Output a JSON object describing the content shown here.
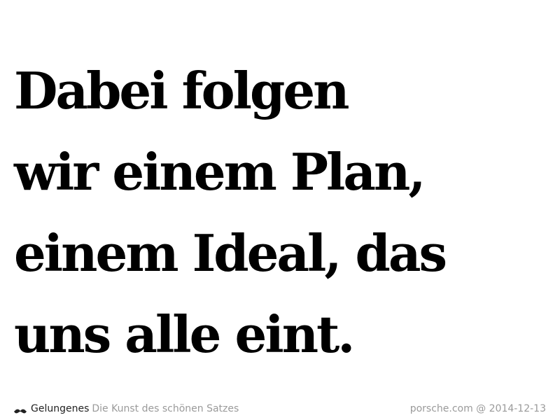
{
  "quote": {
    "lines": [
      "Dabei folgen",
      "wir einem Plan,",
      "einem Ideal, das",
      "uns alle eint."
    ]
  },
  "footer": {
    "icon": "mustache-icon",
    "brand": "Gelungenes",
    "tagline": "Die Kunst des schönen Satzes",
    "source": "porsche.com @ 2014-12-13"
  },
  "colors": {
    "text": "#000000",
    "muted": "#9a9a9a",
    "background": "#ffffff"
  }
}
